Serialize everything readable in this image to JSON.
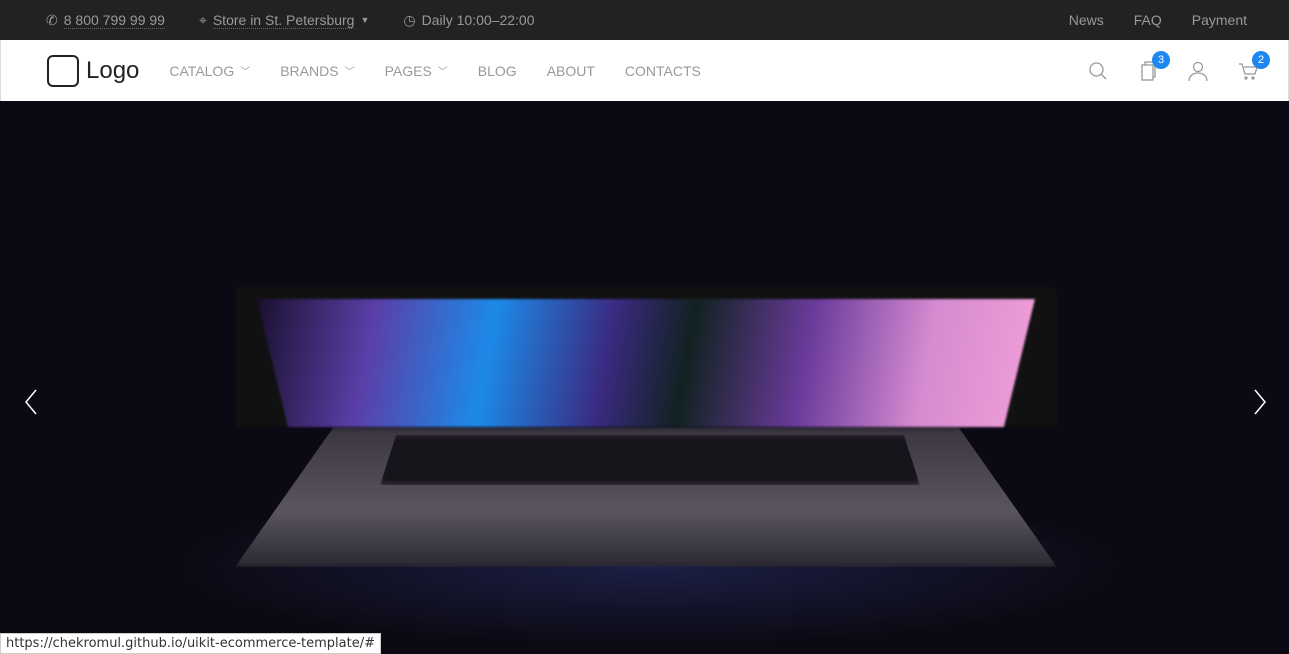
{
  "topbar": {
    "phone": "8 800 799 99 99",
    "store": "Store in St. Petersburg",
    "hours": "Daily 10:00–22:00",
    "links": [
      "News",
      "FAQ",
      "Payment"
    ]
  },
  "nav": {
    "logo": "Logo",
    "menu": [
      {
        "label": "CATALOG",
        "dropdown": true
      },
      {
        "label": "BRANDS",
        "dropdown": true
      },
      {
        "label": "PAGES",
        "dropdown": true
      },
      {
        "label": "BLOG"
      },
      {
        "label": "ABOUT"
      },
      {
        "label": "CONTACTS"
      }
    ],
    "compare_count": "3",
    "cart_count": "2",
    "badge_color": "#1e87f0"
  },
  "status_url": "https://chekromul.github.io/uikit-ecommerce-template/#"
}
